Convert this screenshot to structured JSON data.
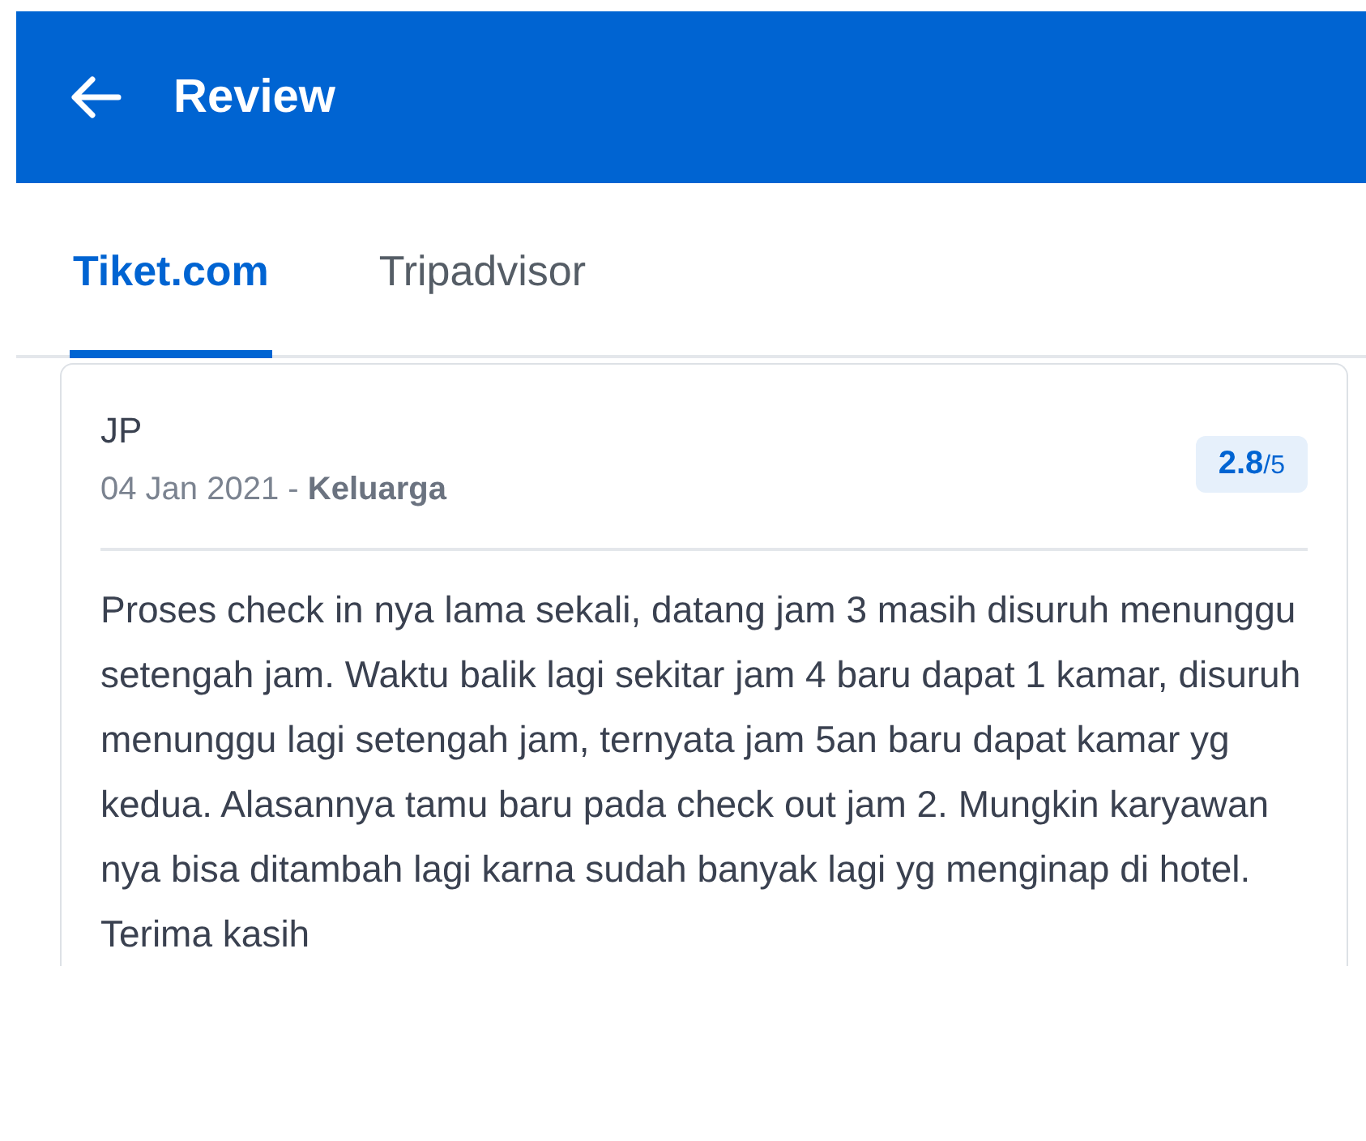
{
  "header": {
    "title": "Review"
  },
  "tabs": [
    {
      "label": "Tiket.com",
      "selected": true
    },
    {
      "label": "Tripadvisor",
      "selected": false
    }
  ],
  "review": {
    "author": "JP",
    "meta": "04 Jan 2021 - **Keluarga**",
    "score": "2.8",
    "scale": "/5",
    "text": "Proses check in nya lama sekali, datang jam 3 masih disuruh menunggu setengah jam. Waktu balik lagi sekitar jam 4 baru dapat 1 kamar, disuruh menunggu lagi setengah jam, ternyata jam 5an baru dapat kamar yg kedua. Alasannya tamu baru pada check out jam 2. Mungkin karyawan nya bisa ditambah lagi karna sudah banyak lagi yg menginap di hotel. Terima kasih"
  }
}
